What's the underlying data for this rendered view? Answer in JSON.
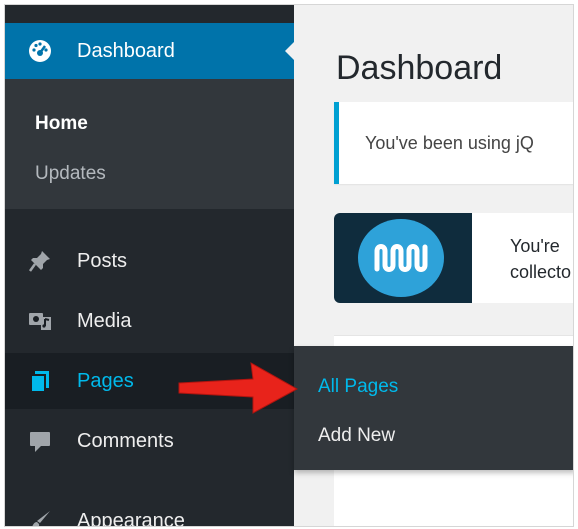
{
  "sidebar": {
    "dashboard_label": "Dashboard",
    "submenu": {
      "home": "Home",
      "updates": "Updates"
    },
    "items": [
      {
        "label": "Posts",
        "icon": "pin-icon"
      },
      {
        "label": "Media",
        "icon": "media-icon"
      },
      {
        "label": "Pages",
        "icon": "pages-icon"
      },
      {
        "label": "Comments",
        "icon": "comment-icon"
      },
      {
        "label": "Appearance",
        "icon": "brush-icon"
      }
    ]
  },
  "flyout": {
    "all_pages": "All Pages",
    "add_new": "Add New"
  },
  "main": {
    "title": "Dashboard",
    "notice1": "You've been using jQ",
    "notice2": {
      "line1": "You're",
      "line2": "collecto"
    }
  },
  "colors": {
    "sidebar": "#23282d",
    "active": "#0073aa",
    "highlight": "#00b9eb",
    "annotation": "#e8231b"
  }
}
